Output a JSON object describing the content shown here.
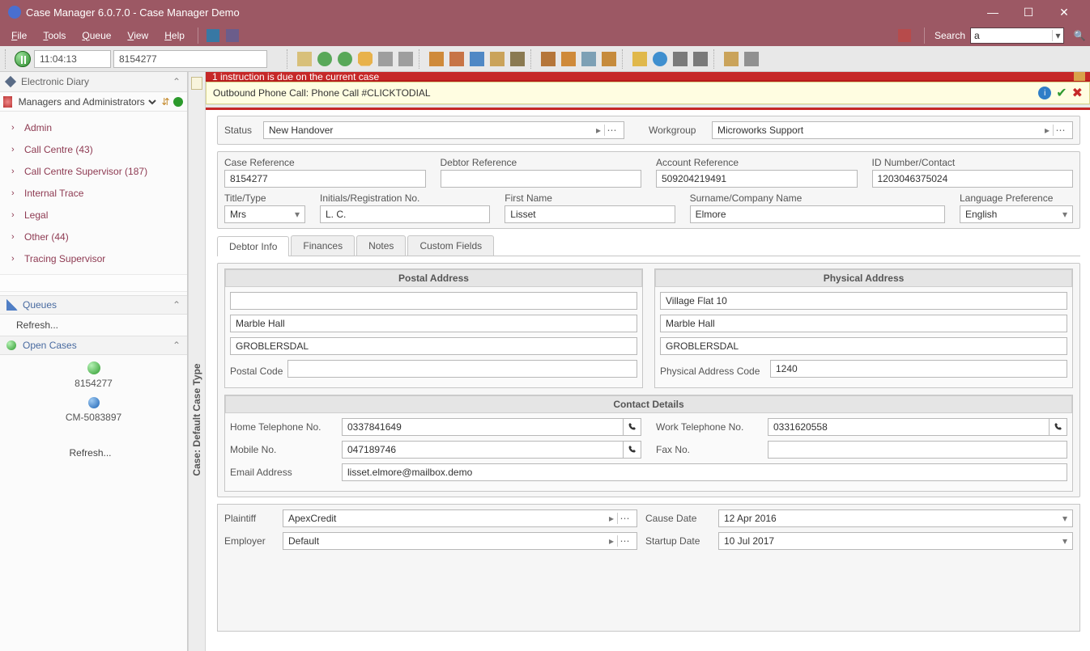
{
  "window": {
    "title": "Case Manager 6.0.7.0 - Case Manager Demo"
  },
  "menus": {
    "file": "File",
    "tools": "Tools",
    "queue": "Queue",
    "view": "View",
    "help": "Help",
    "search": "Search",
    "search_value": "a"
  },
  "clock": {
    "time": "11:04:13",
    "case_no": "8154277"
  },
  "alert": {
    "line1": "1 instruction is due on the current case",
    "line2": "Outbound Phone Call: Phone Call #CLICKTODIAL"
  },
  "sidebar": {
    "diary": "Electronic Diary",
    "managers": "Managers and Administrators",
    "tree": [
      "Admin",
      "Call Centre (43)",
      "Call Centre Supervisor (187)",
      "Internal Trace",
      "Legal",
      "Other (44)",
      "Tracing Supervisor"
    ],
    "queues": "Queues",
    "refresh": "Refresh...",
    "open_cases": "Open Cases",
    "cases": [
      "8154277",
      "CM-5083897"
    ]
  },
  "vlabel": "Case: Default Case Type",
  "form": {
    "status_lbl": "Status",
    "status_val": "New Handover",
    "workgroup_lbl": "Workgroup",
    "workgroup_val": "Microworks Support",
    "caseref_lbl": "Case Reference",
    "caseref_val": "8154277",
    "debref_lbl": "Debtor Reference",
    "debref_val": "",
    "accref_lbl": "Account Reference",
    "accref_val": "509204219491",
    "idnum_lbl": "ID Number/Contact",
    "idnum_val": "1203046375024",
    "title_lbl": "Title/Type",
    "title_val": "Mrs",
    "init_lbl": "Initials/Registration No.",
    "init_val": "L. C.",
    "fname_lbl": "First Name",
    "fname_val": "Lisset",
    "sname_lbl": "Surname/Company Name",
    "sname_val": "Elmore",
    "lang_lbl": "Language Preference",
    "lang_val": "English"
  },
  "tabs": {
    "debtor": "Debtor Info",
    "finances": "Finances",
    "notes": "Notes",
    "custom": "Custom Fields"
  },
  "postal": {
    "title": "Postal Address",
    "l1": "",
    "l2": "Marble Hall",
    "l3": "GROBLERSDAL",
    "code_lbl": "Postal Code",
    "code_val": ""
  },
  "physical": {
    "title": "Physical Address",
    "l1": "Village Flat 10",
    "l2": "Marble Hall",
    "l3": "GROBLERSDAL",
    "code_lbl": "Physical Address Code",
    "code_val": "1240"
  },
  "contact": {
    "title": "Contact Details",
    "home_lbl": "Home Telephone No.",
    "home_val": "0337841649",
    "work_lbl": "Work Telephone No.",
    "work_val": "0331620558",
    "mobile_lbl": "Mobile No.",
    "mobile_val": "047189746",
    "fax_lbl": "Fax No.",
    "fax_val": "",
    "email_lbl": "Email Address",
    "email_val": "lisset.elmore@mailbox.demo"
  },
  "plaint": {
    "plaintiff_lbl": "Plaintiff",
    "plaintiff_val": "ApexCredit",
    "employer_lbl": "Employer",
    "employer_val": "Default",
    "cause_lbl": "Cause Date",
    "cause_val": "12 Apr 2016",
    "startup_lbl": "Startup Date",
    "startup_val": "10 Jul 2017"
  }
}
